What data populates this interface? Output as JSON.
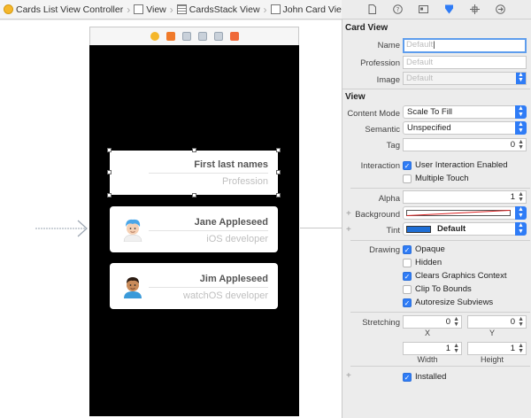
{
  "breadcrumb": [
    {
      "label": "Cards List View Controller",
      "icon": "view-controller-icon"
    },
    {
      "label": "View",
      "icon": "view-icon"
    },
    {
      "label": "CardsStack View",
      "icon": "stack-view-icon"
    },
    {
      "label": "John Card View",
      "icon": "view-icon"
    }
  ],
  "canvas": {
    "cards": [
      {
        "name": "First last names",
        "profession": "Profession",
        "selected": true,
        "avatar": "none"
      },
      {
        "name": "Jane Appleseed",
        "profession": "iOS developer",
        "avatar": "blue-hair-avatar"
      },
      {
        "name": "Jim Appleseed",
        "profession": "watchOS developer",
        "avatar": "dark-hair-avatar"
      }
    ]
  },
  "inspector": {
    "tabs": [
      "file-icon",
      "help-icon",
      "identity-icon",
      "attributes-icon",
      "size-icon",
      "connections-icon"
    ],
    "card_view": {
      "title": "Card View",
      "name_label": "Name",
      "name_placeholder": "Default",
      "profession_label": "Profession",
      "profession_placeholder": "Default",
      "image_label": "Image",
      "image_placeholder": "Default"
    },
    "view": {
      "title": "View",
      "content_mode_label": "Content Mode",
      "content_mode_value": "Scale To Fill",
      "semantic_label": "Semantic",
      "semantic_value": "Unspecified",
      "tag_label": "Tag",
      "tag_value": "0",
      "interaction_label": "Interaction",
      "user_interaction_label": "User Interaction Enabled",
      "user_interaction_checked": true,
      "multiple_touch_label": "Multiple Touch",
      "multiple_touch_checked": false,
      "alpha_label": "Alpha",
      "alpha_value": "1",
      "background_label": "Background",
      "tint_label": "Tint",
      "tint_value": "Default",
      "tint_color": "#1f6fd6",
      "drawing_label": "Drawing",
      "opaque_label": "Opaque",
      "opaque_checked": true,
      "hidden_label": "Hidden",
      "hidden_checked": false,
      "clears_label": "Clears Graphics Context",
      "clears_checked": true,
      "clip_label": "Clip To Bounds",
      "clip_checked": false,
      "autoresize_label": "Autoresize Subviews",
      "autoresize_checked": true,
      "stretching_label": "Stretching",
      "stretch_x_value": "0",
      "stretch_y_value": "0",
      "x_label": "X",
      "y_label": "Y",
      "width_value": "1",
      "height_value": "1",
      "width_label": "Width",
      "height_label": "Height",
      "installed_label": "Installed",
      "installed_checked": true
    }
  },
  "colors": {
    "accent": "#2f7cf6",
    "scene": "#000000",
    "focus": "#5e9ded"
  }
}
